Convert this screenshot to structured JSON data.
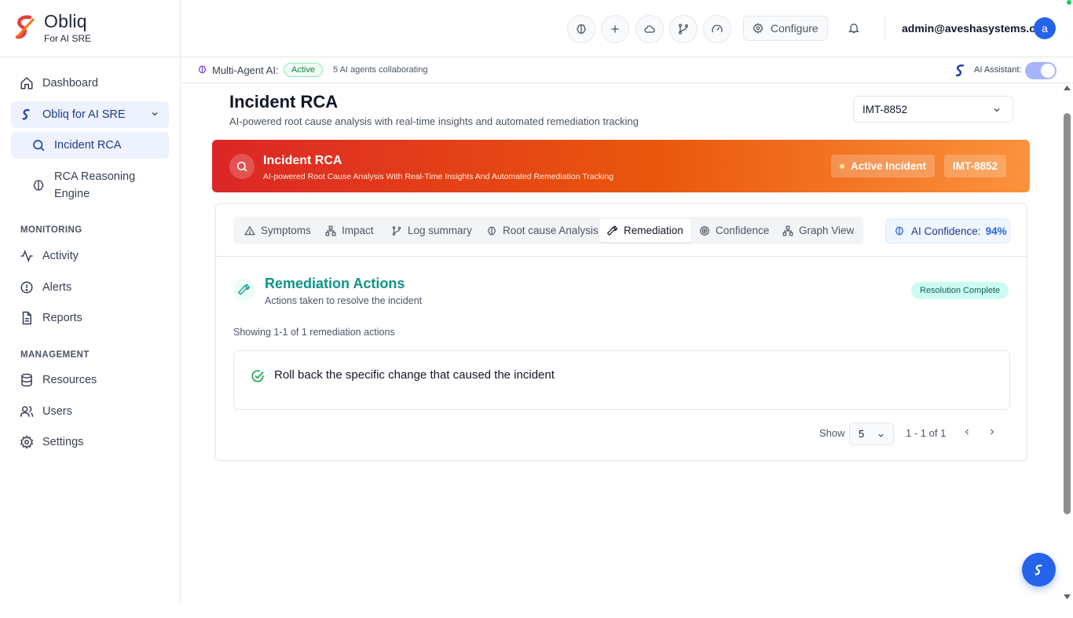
{
  "brand": {
    "name": "Obliq",
    "subtitle": "For AI SRE",
    "accent": "#e53e3e"
  },
  "sidebar": {
    "dashboard": "Dashboard",
    "group": "Obliq for AI SRE",
    "incident_rca": "Incident RCA",
    "rca_engine_line1": "RCA Reasoning",
    "rca_engine_line2": "Engine",
    "monitoring_label": "MONITORING",
    "activity": "Activity",
    "alerts": "Alerts",
    "reports": "Reports",
    "management_label": "MANAGEMENT",
    "resources": "Resources",
    "users": "Users",
    "settings": "Settings"
  },
  "header": {
    "configure": "Configure",
    "user_email": "admin@aveshasystems.com",
    "avatar_letter": "a"
  },
  "subbar": {
    "multi_agent_label": "Multi-Agent AI:",
    "status": "Active",
    "agents_note": "5 AI agents collaborating",
    "ai_assistant_label": "AI Assistant:",
    "ai_assistant_on": true
  },
  "page": {
    "title": "Incident RCA",
    "subtitle": "AI-powered root cause analysis with real-time insights and automated remediation tracking",
    "selected_incident": "IMT-8852"
  },
  "banner": {
    "title": "Incident RCA",
    "subtitle": "AI-powered Root Cause Analysis With Real-Time Insights And Automated Remediation Tracking",
    "status_badge": "Active Incident",
    "id_badge": "IMT-8852"
  },
  "tabs": {
    "symptoms": "Symptoms",
    "impact": "Impact",
    "log_summary": "Log summary",
    "root_cause": "Root cause Analysis",
    "remediation": "Remediation",
    "confidence": "Confidence",
    "graph_view": "Graph View",
    "active": "Remediation"
  },
  "ai_confidence": {
    "label": "AI Confidence:",
    "value": "94%"
  },
  "remediation": {
    "title": "Remediation Actions",
    "subtitle": "Actions taken to resolve the incident",
    "status_badge": "Resolution Complete",
    "showing": "Showing 1-1 of 1 remediation actions",
    "actions": [
      {
        "text": "Roll back the specific change that caused the incident",
        "done": true
      }
    ]
  },
  "pager": {
    "show_label": "Show",
    "page_size": "5",
    "range": "1 - 1 of 1"
  }
}
